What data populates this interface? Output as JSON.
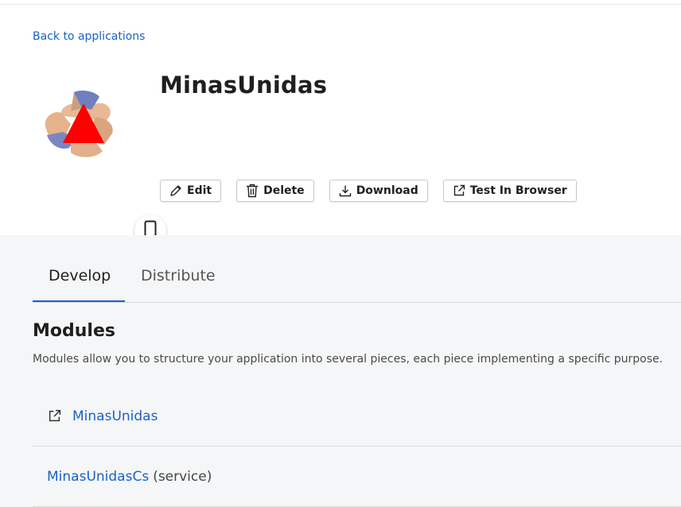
{
  "header": {
    "back_link": "Back to applications",
    "app_title": "MinasUnidas",
    "icons": {
      "app_logo": "minas-unidas-logo",
      "device": "mobile-phone-icon"
    }
  },
  "actions": {
    "edit": "Edit",
    "delete": "Delete",
    "download": "Download",
    "test_in_browser": "Test In Browser"
  },
  "tabs": [
    {
      "label": "Develop",
      "active": true
    },
    {
      "label": "Distribute",
      "active": false
    }
  ],
  "modules": {
    "title": "Modules",
    "description": "Modules allow you to structure your application into several pieces, each piece implementing a specific purpose.",
    "items": [
      {
        "name": "MinasUnidas",
        "suffix": "",
        "icon": "external-link-icon"
      },
      {
        "name": "MinasUnidasCs",
        "suffix": "(service)",
        "icon": ""
      }
    ]
  },
  "colors": {
    "accent": "#1a62c5",
    "lower_bg": "#f5f6f7",
    "logo_triangle": "#ff0000"
  }
}
